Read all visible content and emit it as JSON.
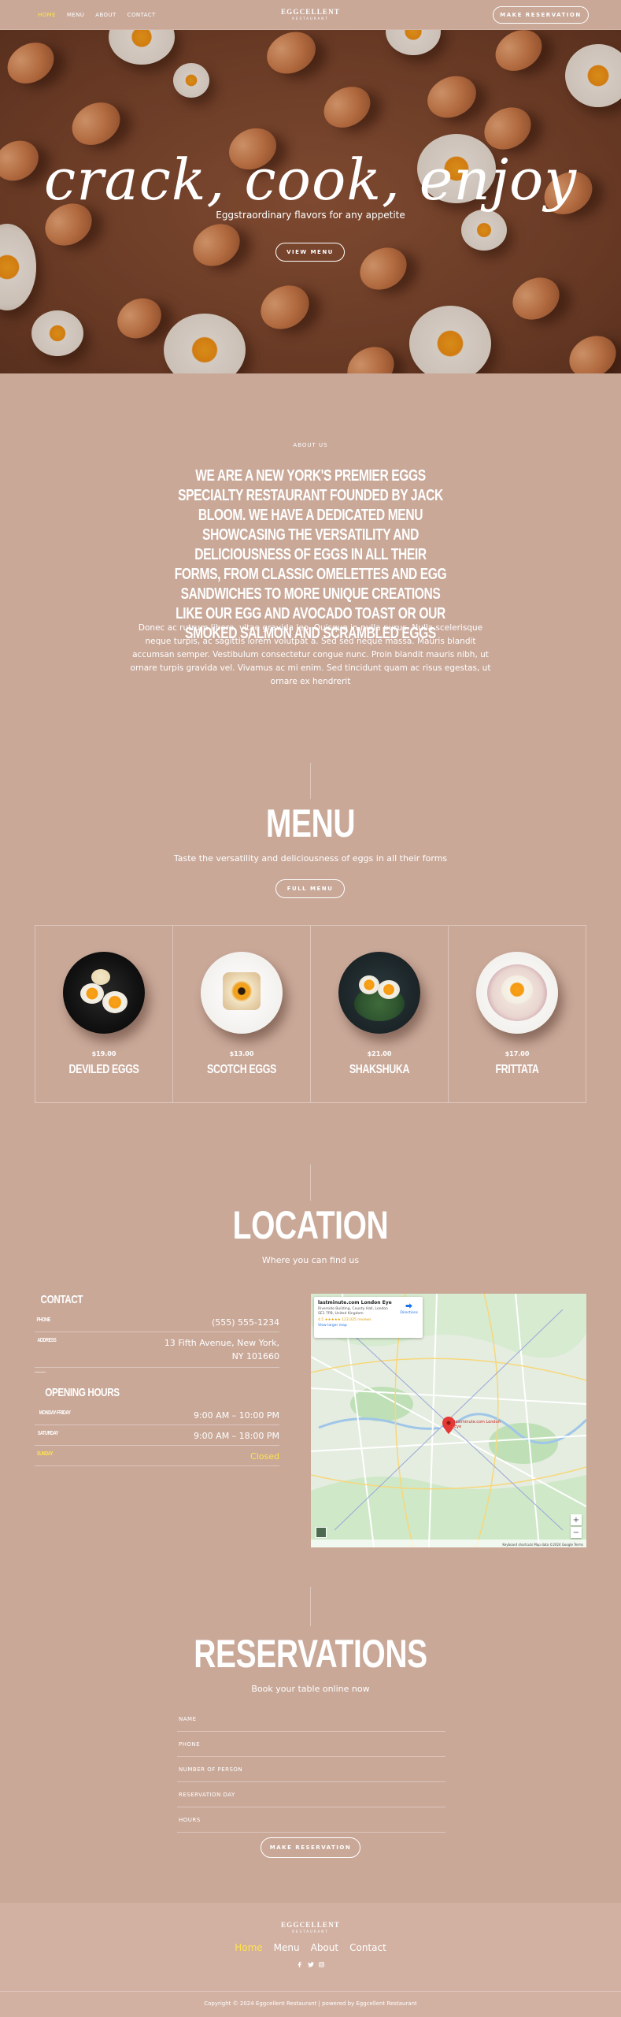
{
  "header": {
    "nav": [
      "Home",
      "Menu",
      "About",
      "Contact"
    ],
    "logo_line1": "EGGCELLENT",
    "logo_line2": "RESTAURANT",
    "button": "MAKE RESERVATION"
  },
  "hero": {
    "title": "crack, cook, enjoy",
    "subtitle": "Eggstraordinary flavors for any appetite",
    "button": "VIEW MENU"
  },
  "about": {
    "label": "ABOUT US",
    "heading": "We are a New York's premier eggs specialty restaurant founded by Jack Bloom. We have a dedicated menu showcasing the versatility and deliciousness of eggs in all their forms, from classic omelettes and egg sandwiches to more unique creations like our egg and avocado toast or our smoked salmon and scrambled eggs",
    "body": "Donec ac rutrum libero, vitae gravida leo. Quisque in nulla purus. Nulla scelerisque neque turpis, ac sagittis lorem volutpat a. Sed sed neque massa. Mauris blandit accumsan semper. Vestibulum consectetur congue nunc. Proin blandit mauris nibh, ut ornare turpis gravida vel. Vivamus ac mi enim. Sed tincidunt quam ac risus egestas, ut ornare ex hendrerit"
  },
  "menu": {
    "title": "MENU",
    "subtitle": "Taste the versatility and deliciousness of eggs in all their forms",
    "button": "FULL MENU",
    "items": [
      {
        "price": "$19.00",
        "name": "Deviled Eggs"
      },
      {
        "price": "$13.00",
        "name": "Scotch Eggs"
      },
      {
        "price": "$21.00",
        "name": "Shakshuka"
      },
      {
        "price": "$17.00",
        "name": "Frittata"
      }
    ]
  },
  "location": {
    "title": "LOCATION",
    "subtitle": "Where you can find us",
    "contact_heading": "Contact",
    "phone_label": "PHONE",
    "phone": "(555) 555-1234",
    "address_label": "ADDRESS",
    "address_line1": "13 Fifth Avenue, New York,",
    "address_line2": "NY 101660",
    "hours_heading": "Opening Hours",
    "hours": [
      {
        "day": "MONDAY-FRIDAY",
        "time": "9:00 AM – 10:00 PM",
        "highlight": false
      },
      {
        "day": "SATURDAY",
        "time": "9:00 AM – 18:00 PM",
        "highlight": false
      },
      {
        "day": "SUNDAY",
        "time": "Closed",
        "highlight": true
      }
    ],
    "map": {
      "place": "lastminute.com London Eye",
      "address": "Riverside Building, County Hall, London SE1 7PB, United Kingdom",
      "rating": "4.5 ★★★★★ 123,025 reviews",
      "larger_link": "View larger map",
      "directions": "Directions",
      "pin_label": "lastminute.com London Eye",
      "footer_text": "Keyboard shortcuts   Map data ©2024 Google   Terms"
    }
  },
  "reservations": {
    "title": "RESERVATIONS",
    "subtitle": "Book your table online now",
    "fields": [
      "NAME",
      "PHONE",
      "NUMBER OF PERSON",
      "RESERVATION DAY",
      "HOURS"
    ],
    "button": "MAKE RESERVATION"
  },
  "footer": {
    "logo_line1": "EGGCELLENT",
    "logo_line2": "RESTAURANT",
    "nav": [
      "Home",
      "Menu",
      "About",
      "Contact"
    ],
    "social": [
      "facebook-icon",
      "twitter-icon",
      "instagram-icon"
    ],
    "copyright": "Copyright © 2024 Eggcellent Restaurant | powered by Eggcellent Restaurant"
  },
  "colors": {
    "background": "#c9a898",
    "accent": "#ffe34d",
    "footer": "#d2b1a2"
  }
}
